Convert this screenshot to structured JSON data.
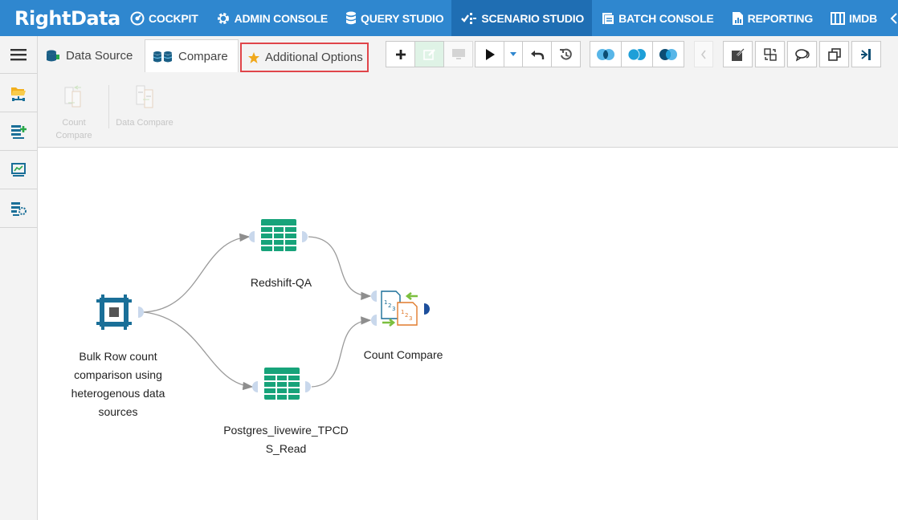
{
  "brand": {
    "logo_text": "RightData"
  },
  "nav": {
    "items": [
      {
        "label": "COCKPIT"
      },
      {
        "label": "ADMIN CONSOLE"
      },
      {
        "label": "QUERY STUDIO"
      },
      {
        "label": "SCENARIO STUDIO"
      },
      {
        "label": "BATCH CONSOLE"
      },
      {
        "label": "REPORTING"
      },
      {
        "label": "IMDB"
      }
    ],
    "active_index": 3
  },
  "tabs": {
    "data_source": "Data Source",
    "compare": "Compare",
    "additional_options": "Additional Options"
  },
  "ribbon": {
    "count_compare_line1": "Count",
    "count_compare_line2": "Compare",
    "data_compare": "Data Compare"
  },
  "canvas": {
    "nodes": {
      "source": {
        "lines": [
          "Bulk Row count",
          "comparison using",
          "heterogenous data",
          "sources"
        ]
      },
      "redshift": {
        "label": "Redshift-QA"
      },
      "postgres": {
        "lines": [
          "Postgres_livewire_TPCD",
          "S_Read"
        ]
      },
      "count_compare": {
        "label": "Count Compare"
      }
    }
  },
  "colors": {
    "nav_bg": "#2f87cf",
    "nav_active": "#1f6eb3",
    "table_green": "#17a37a",
    "source_blue": "#1a6f98",
    "highlight_red": "#e0454a"
  },
  "icons": {
    "cockpit": "gauge-icon",
    "admin": "gear-icon",
    "query": "database-icon",
    "scenario": "scenario-icon",
    "batch": "batch-icon",
    "reporting": "report-icon",
    "imdb": "columns-icon"
  }
}
